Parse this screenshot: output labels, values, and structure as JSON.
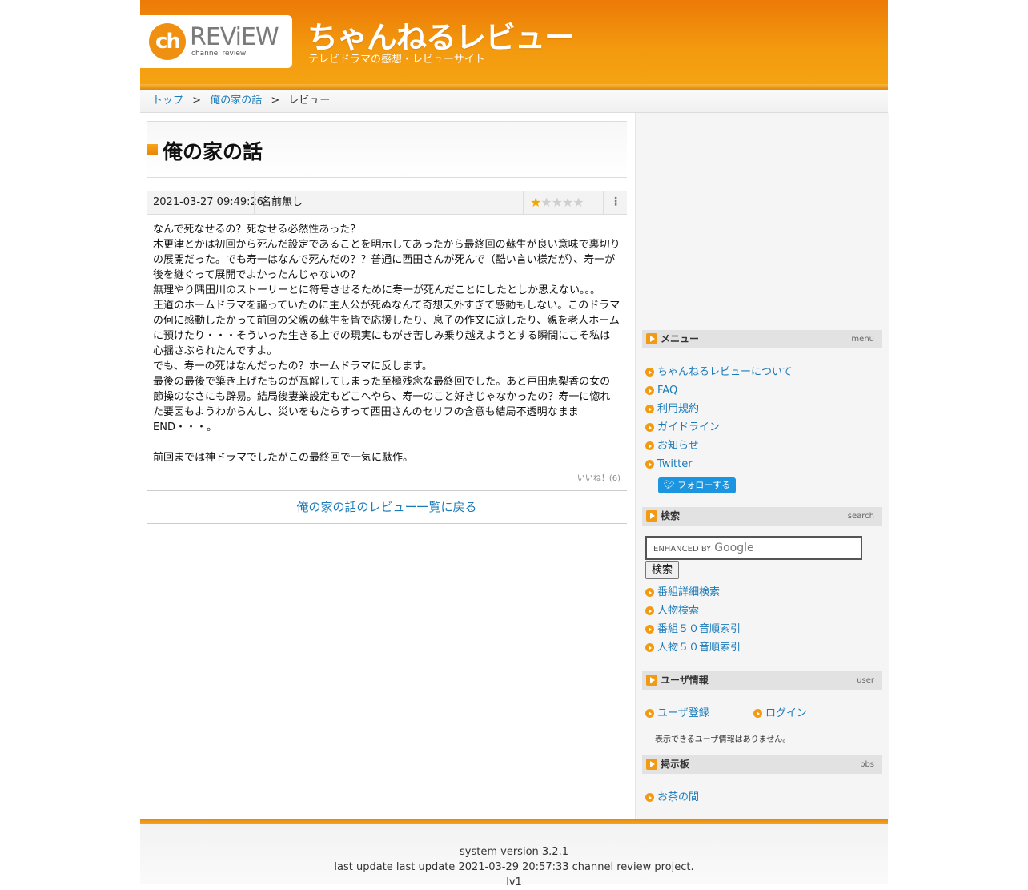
{
  "header": {
    "logo_mark": "ch",
    "logo_word": "REViEW",
    "logo_sub": "channel review",
    "site_title": "ちゃんねるレビュー",
    "tagline": "テレビドラマの感想・レビューサイト"
  },
  "breadcrumb": {
    "items": [
      "トップ",
      "俺の家の話",
      "レビュー"
    ],
    "separator": ">"
  },
  "main": {
    "title": "俺の家の話",
    "review": {
      "date": "2021-03-27 09:49:26",
      "author": "名前無し",
      "rating": 1,
      "rating_max": 5,
      "menu_glyph": "⋮",
      "paragraphs": [
        "なんで死なせるの？死なせる必然性あった？",
        "木更津とかは初回から死んだ設定であることを明示してあったから最終回の蘇生が良い意味で裏切りの展開だった。でも寿一はなんで死んだの？？普通に西田さんが死んで（酷い言い様だが）、寿一が後を継ぐって展開でよかったんじゃないの？",
        "無理やり隅田川のストーリーとに符号させるために寿一が死んだことにしたとしか思えない。。。",
        "王道のホームドラマを謳っていたのに主人公が死ぬなんて奇想天外すぎて感動もしない。このドラマの何に感動したかって前回の父親の蘇生を皆で応援したり、息子の作文に涙したり、親を老人ホームに預けたり・・・そういった生きる上での現実にもがき苦しみ乗り越えようとする瞬間にこそ私は心揺さぶられたんですよ。",
        "でも、寿一の死はなんだったの？ホームドラマに反します。",
        "最後の最後で築き上げたものが瓦解してしまった至極残念な最終回でした。あと戸田恵梨香の女の節操のなさにも辟易。結局後妻業設定もどこへやら、寿一のこと好きじゃなかったの？寿一に惚れた要因もようわからんし、災いをもたらすって西田さんのセリフの含意も結局不透明なままEND・・・。",
        "",
        "前回までは神ドラマでしたがこの最終回で一気に駄作。"
      ],
      "likes": "いいね！(6)"
    },
    "back_link": "俺の家の話のレビュー一覧に戻る"
  },
  "sidebar": {
    "menu": {
      "title": "メニュー",
      "en": "menu",
      "items": [
        "ちゃんねるレビューについて",
        "FAQ",
        "利用規約",
        "ガイドライン",
        "お知らせ",
        "Twitter"
      ],
      "follow_button": "フォローする"
    },
    "search": {
      "title": "検索",
      "en": "search",
      "placeholder": "ENHANCED BY",
      "placeholder_brand": "Google",
      "button": "検索",
      "items": [
        "番組詳細検索",
        "人物検索",
        "番組５０音順索引",
        "人物５０音順索引"
      ]
    },
    "user": {
      "title": "ユーザ情報",
      "en": "user",
      "register": "ユーザ登録",
      "login": "ログイン",
      "note": "表示できるユーザ情報はありません。"
    },
    "bbs": {
      "title": "掲示板",
      "en": "bbs",
      "items": [
        "お茶の間"
      ]
    }
  },
  "footer": {
    "line1": "system version 3.2.1",
    "line2": "last update last update 2021-03-29 20:57:33 channel review project.",
    "line3": "lv1"
  },
  "colors": {
    "accent_orange": "#f29b12",
    "link_blue": "#1a7bb9",
    "twitter_blue": "#1b95e0"
  }
}
